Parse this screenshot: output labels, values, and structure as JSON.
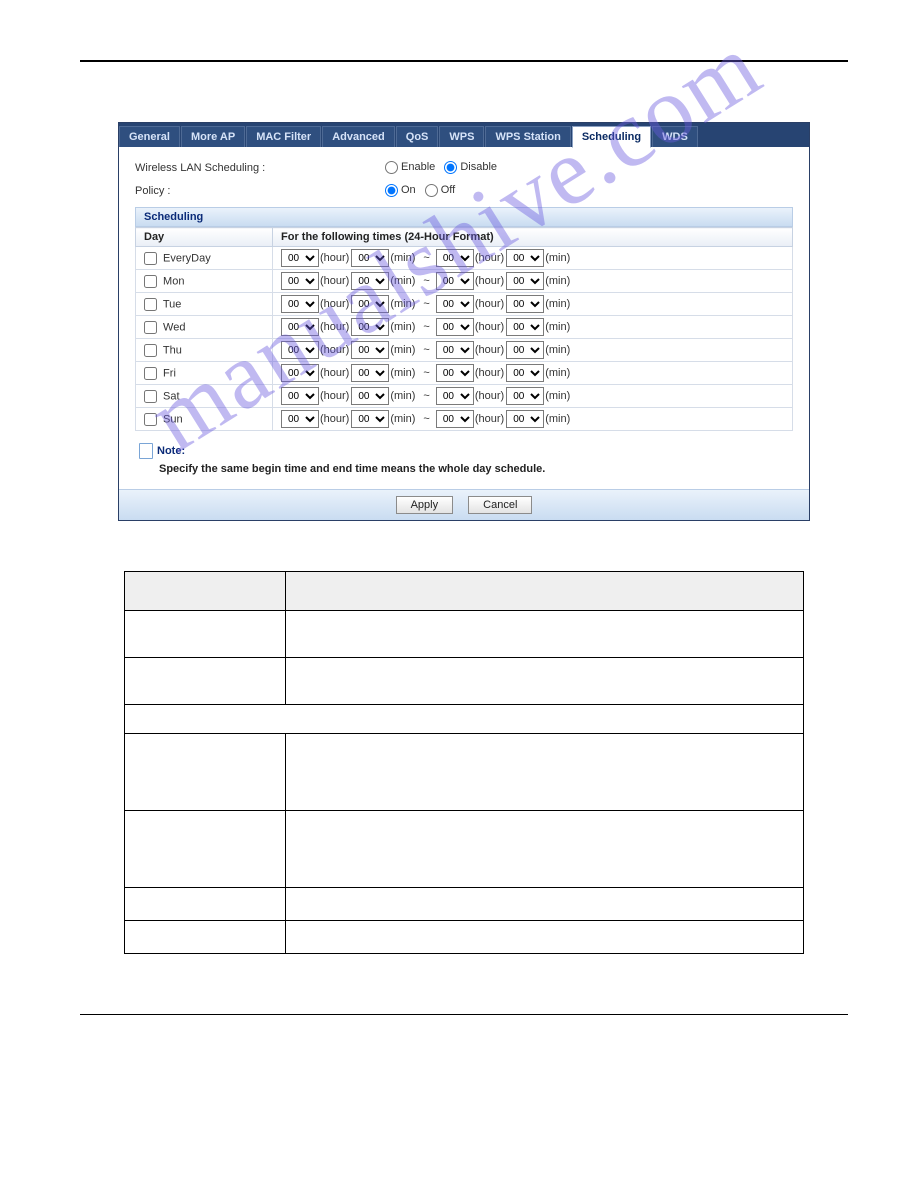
{
  "watermark_text": "manualshive.com",
  "tabs": [
    {
      "label": "General"
    },
    {
      "label": "More AP"
    },
    {
      "label": "MAC Filter"
    },
    {
      "label": "Advanced"
    },
    {
      "label": "QoS"
    },
    {
      "label": "WPS"
    },
    {
      "label": "WPS Station"
    },
    {
      "label": "Scheduling"
    },
    {
      "label": "WDS"
    }
  ],
  "active_tab_index": 7,
  "form": {
    "wlan_sched_label": "Wireless LAN Scheduling :",
    "policy_label": "Policy :",
    "enable_label": "Enable",
    "disable_label": "Disable",
    "on_label": "On",
    "off_label": "Off",
    "wlan_sched_value": "Disable",
    "policy_value": "On"
  },
  "scheduling": {
    "section_title": "Scheduling",
    "day_header": "Day",
    "times_header": "For the following times (24-Hour Format)",
    "hour_unit": "(hour)",
    "min_unit": "(min)",
    "separator": "~",
    "default_value": "00",
    "days": [
      {
        "name": "EveryDay"
      },
      {
        "name": "Mon"
      },
      {
        "name": "Tue"
      },
      {
        "name": "Wed"
      },
      {
        "name": "Thu"
      },
      {
        "name": "Fri"
      },
      {
        "name": "Sat"
      },
      {
        "name": "Sun"
      }
    ]
  },
  "note": {
    "title": "Note:",
    "text": "Specify the same begin time and end time means the whole day schedule."
  },
  "buttons": {
    "apply": "Apply",
    "cancel": "Cancel"
  }
}
